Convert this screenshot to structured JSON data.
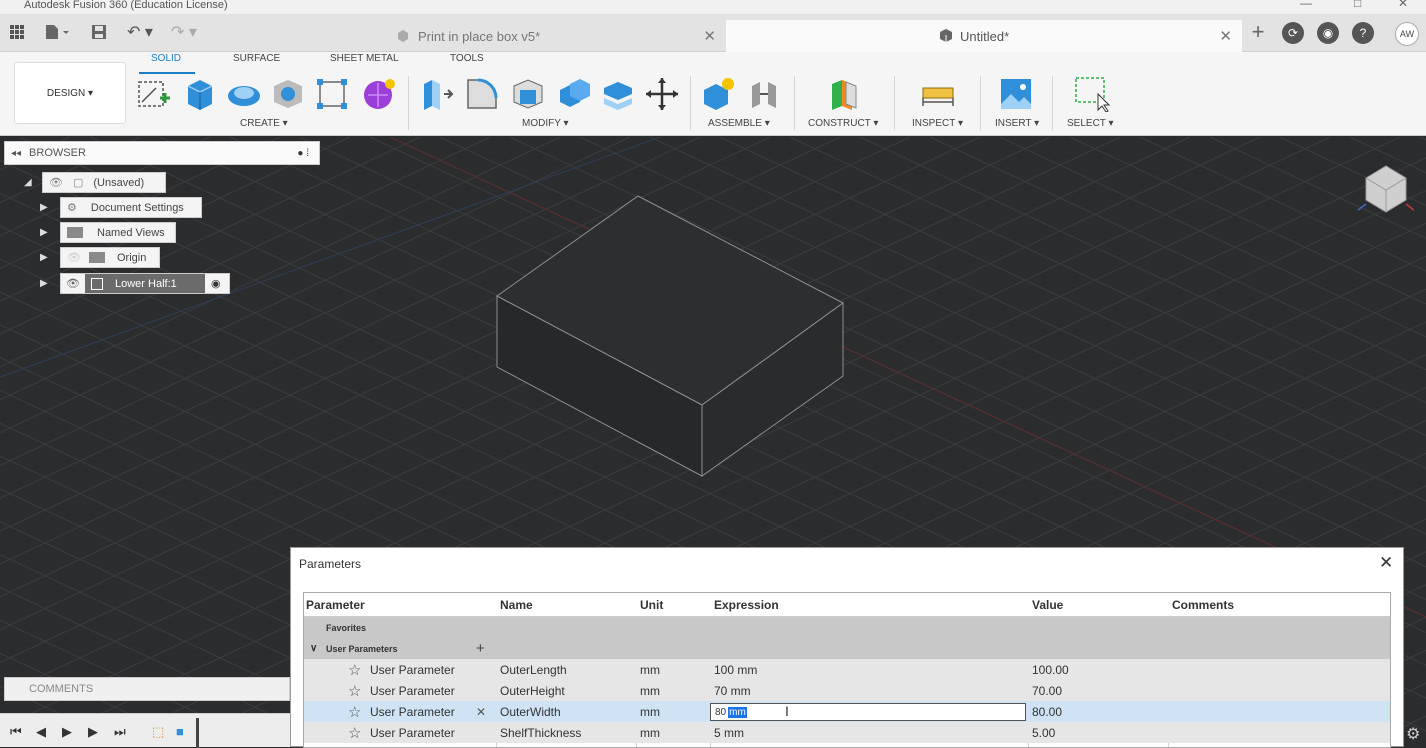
{
  "window": {
    "title": "Autodesk Fusion 360 (Education License)"
  },
  "tabs": [
    {
      "label": "Print in place box v5*",
      "active": false
    },
    {
      "label": "Untitled*",
      "active": true
    }
  ],
  "header": {
    "avatar": "AW"
  },
  "toolbar": {
    "design_label": "DESIGN ▾",
    "tabs": [
      "SOLID",
      "SURFACE",
      "SHEET METAL",
      "TOOLS"
    ],
    "active_tab": "SOLID",
    "groups": [
      "CREATE ▾",
      "MODIFY ▾",
      "ASSEMBLE ▾",
      "CONSTRUCT ▾",
      "INSPECT ▾",
      "INSERT ▾",
      "SELECT ▾"
    ]
  },
  "browser": {
    "title": "BROWSER",
    "items": [
      "(Unsaved)",
      "Document Settings",
      "Named Views",
      "Origin",
      "Lower Half:1"
    ]
  },
  "comments": {
    "label": "COMMENTS"
  },
  "parameters": {
    "title": "Parameters",
    "columns": [
      "Parameter",
      "Name",
      "Unit",
      "Expression",
      "Value",
      "Comments"
    ],
    "groups": [
      "Favorites",
      "User Parameters"
    ],
    "rows": [
      {
        "type": "User Parameter",
        "name": "OuterLength",
        "unit": "mm",
        "expression": "100 mm",
        "value": "100.00",
        "comment": ""
      },
      {
        "type": "User Parameter",
        "name": "OuterHeight",
        "unit": "mm",
        "expression": "70 mm",
        "value": "70.00",
        "comment": ""
      },
      {
        "type": "User Parameter",
        "name": "OuterWidth",
        "unit": "mm",
        "expression_typed": "80",
        "expression_selected": "mm",
        "value": "80.00",
        "comment": "",
        "selected": true
      },
      {
        "type": "User Parameter",
        "name": "ShelfThickness",
        "unit": "mm",
        "expression": "5 mm",
        "value": "5.00",
        "comment": ""
      }
    ]
  },
  "colors": {
    "accent": "#1c7ec6",
    "viewport": "#2b2c2e",
    "selection": "#1a73e8"
  }
}
